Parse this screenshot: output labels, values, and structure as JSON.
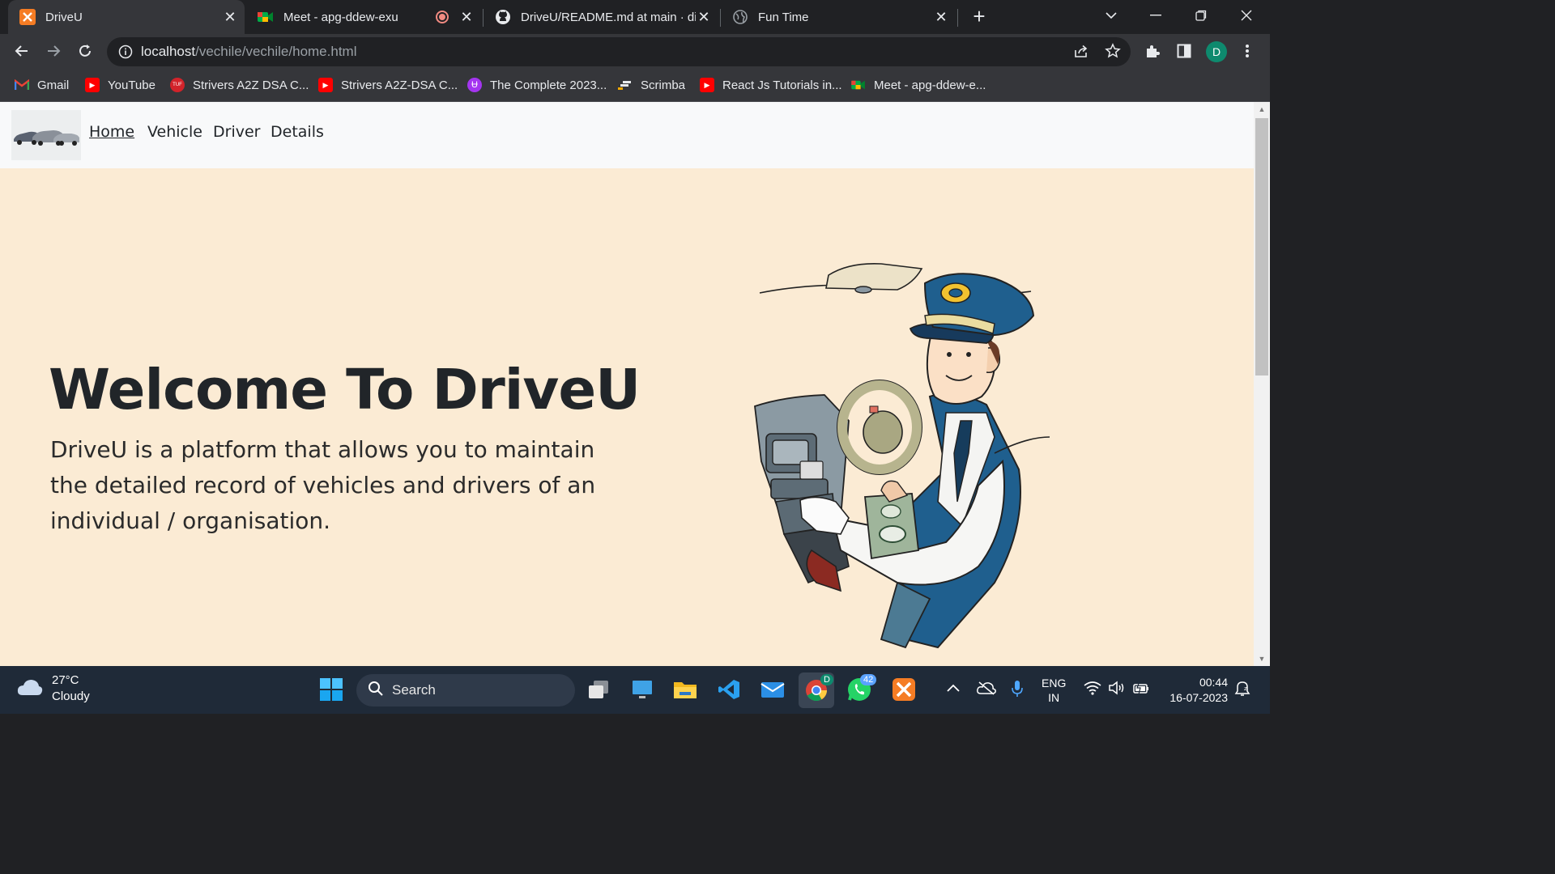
{
  "browser": {
    "tabs": [
      {
        "title": "DriveU",
        "active": true
      },
      {
        "title": "Meet - apg-ddew-exu",
        "active": false
      },
      {
        "title": "DriveU/README.md at main · div",
        "active": false
      },
      {
        "title": "Fun Time",
        "active": false
      }
    ],
    "url_host": "localhost",
    "url_path": "/vechile/vechile/home.html",
    "profile_initial": "D",
    "bookmarks": [
      {
        "label": "Gmail",
        "icon": "gmail-icon"
      },
      {
        "label": "YouTube",
        "icon": "youtube-icon"
      },
      {
        "label": "Strivers A2Z DSA C...",
        "icon": "tuf-icon"
      },
      {
        "label": "Strivers A2Z-DSA C...",
        "icon": "youtube-icon"
      },
      {
        "label": "The Complete 2023...",
        "icon": "udemy-icon"
      },
      {
        "label": "Scrimba",
        "icon": "scrimba-icon"
      },
      {
        "label": "React Js Tutorials in...",
        "icon": "youtube-icon"
      },
      {
        "label": "Meet - apg-ddew-e...",
        "icon": "meet-icon"
      }
    ]
  },
  "site": {
    "nav": {
      "links": [
        "Home",
        "Vehicle",
        "Driver",
        "Details"
      ]
    },
    "hero": {
      "title": "Welcome To DriveU",
      "description": "DriveU is a platform that allows you to maintain the detailed record of vehicles and drivers of an individual / organisation."
    }
  },
  "taskbar": {
    "weather_temp": "27°C",
    "weather_desc": "Cloudy",
    "search_label": "Search",
    "whatsapp_badge": "42",
    "language": "ENG",
    "region": "IN",
    "time": "00:44",
    "date": "16-07-2023"
  }
}
